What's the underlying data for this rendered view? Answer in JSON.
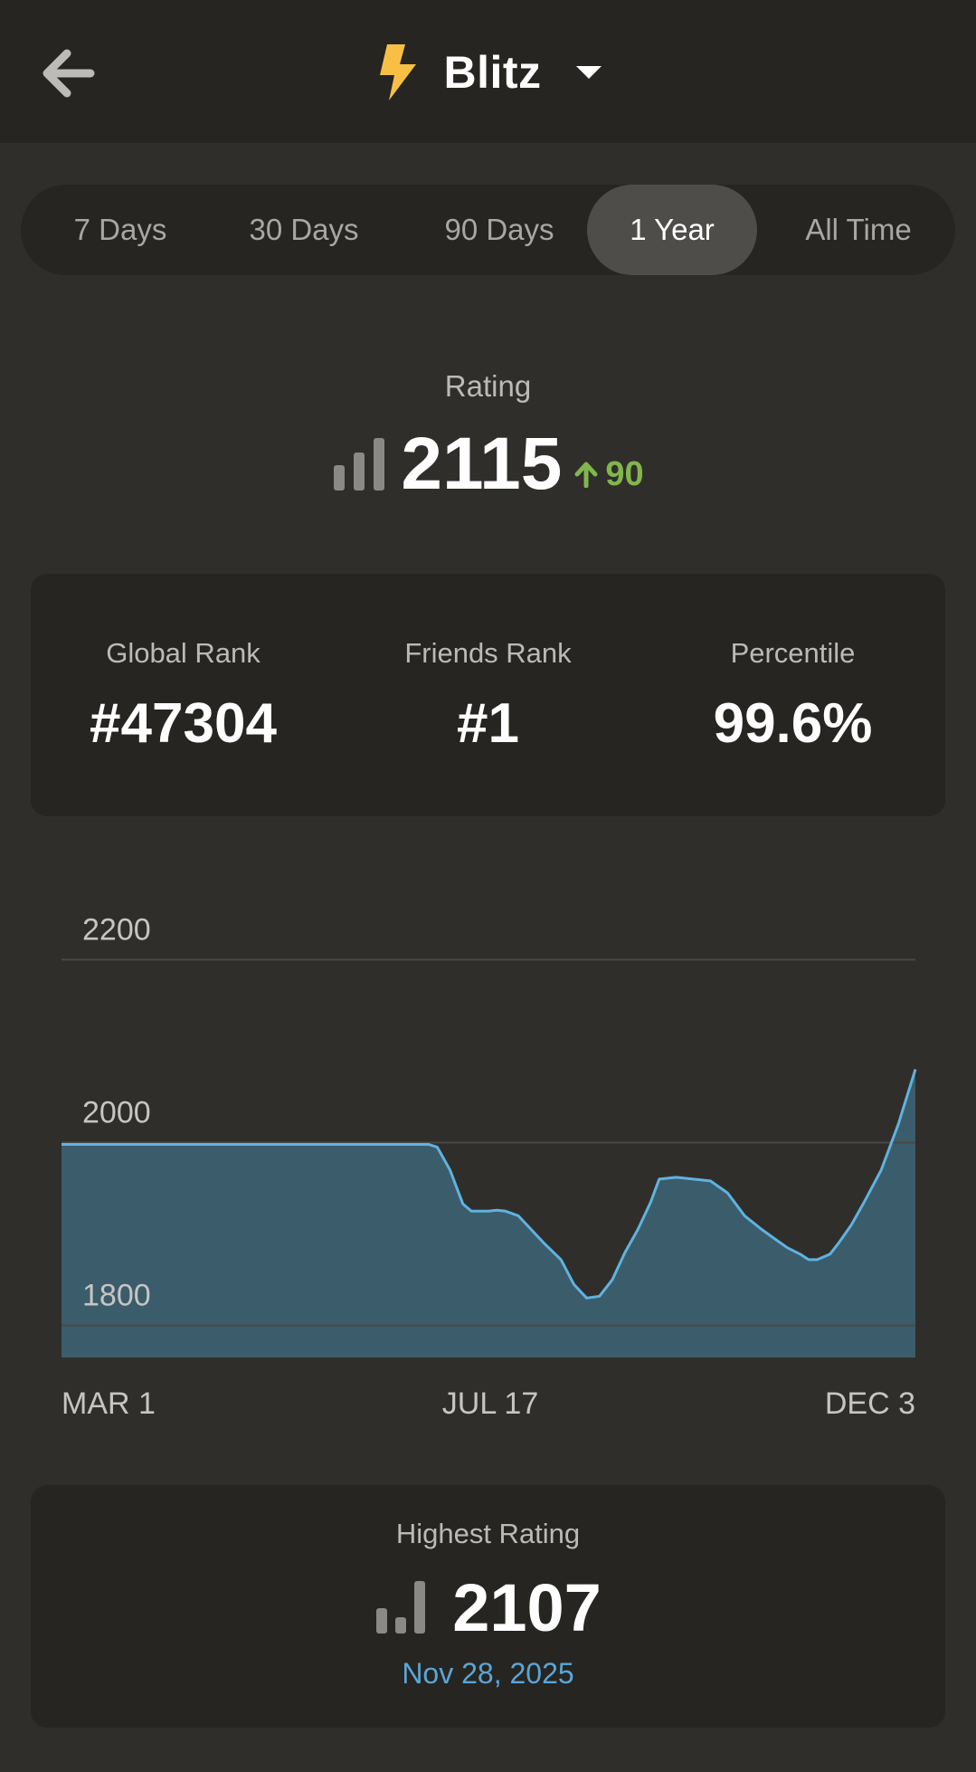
{
  "header": {
    "title": "Blitz",
    "back_icon": "arrow-left-icon",
    "mode_icon": "lightning-bolt-icon",
    "dropdown_icon": "caret-down-icon",
    "accent_color": "#f7c045"
  },
  "tabs": [
    {
      "label": "7 Days",
      "active": false
    },
    {
      "label": "30 Days",
      "active": false
    },
    {
      "label": "90 Days",
      "active": false
    },
    {
      "label": "1 Year",
      "active": true
    },
    {
      "label": "All Time",
      "active": false
    }
  ],
  "rating": {
    "label": "Rating",
    "value": "2115",
    "change": "90",
    "change_icon": "arrow-up-icon",
    "change_color": "#81b64c",
    "icon": "bar-chart-icon"
  },
  "stats": [
    {
      "label": "Global Rank",
      "value": "#47304"
    },
    {
      "label": "Friends Rank",
      "value": "#1"
    },
    {
      "label": "Percentile",
      "value": "99.6%"
    }
  ],
  "chart_data": {
    "type": "area",
    "title": "",
    "xlabel": "",
    "ylabel": "",
    "ylim": [
      1765,
      2235
    ],
    "yticks": [
      2200,
      2000,
      1800
    ],
    "xtick_labels": [
      "MAR 1",
      "JUL 17",
      "DEC 3"
    ],
    "grid": true,
    "line_color": "#5fb3e0",
    "fill_color": "#3b5c6b",
    "series": [
      {
        "x": [
          0,
          0.05,
          0.1,
          0.15,
          0.2,
          0.25,
          0.3,
          0.35,
          0.38,
          0.41,
          0.43,
          0.44,
          0.455,
          0.47,
          0.48,
          0.5,
          0.51,
          0.52,
          0.535,
          0.55,
          0.565,
          0.585,
          0.6,
          0.615,
          0.63,
          0.645,
          0.66,
          0.675,
          0.69,
          0.7,
          0.72,
          0.74,
          0.76,
          0.78,
          0.8,
          0.82,
          0.835,
          0.85,
          0.865,
          0.875,
          0.885,
          0.9,
          0.91,
          0.925,
          0.94,
          0.96,
          0.98,
          1.0
        ],
        "y": [
          1998,
          1998,
          1998,
          1998,
          1998,
          1998,
          1998,
          1998,
          1998,
          1998,
          1998,
          1995,
          1970,
          1933,
          1925,
          1925,
          1926,
          1925,
          1920,
          1905,
          1890,
          1872,
          1845,
          1830,
          1832,
          1850,
          1880,
          1905,
          1935,
          1960,
          1962,
          1960,
          1958,
          1945,
          1920,
          1905,
          1895,
          1885,
          1878,
          1872,
          1872,
          1878,
          1890,
          1910,
          1935,
          1970,
          2020,
          2080
        ]
      }
    ]
  },
  "highest": {
    "label": "Highest Rating",
    "value": "2107",
    "date": "Nov 28, 2025",
    "date_color": "#5aa6d6",
    "icon": "bar-chart-icon"
  }
}
